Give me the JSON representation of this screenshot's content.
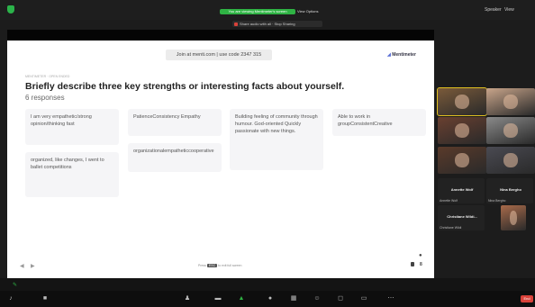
{
  "topbar": {
    "share_banner": "You are viewing Mentimeter's screen",
    "stop_label": "View Options",
    "sharing_note": "Share audio with all · Stop Sharing",
    "view_label": "Speaker",
    "view_label2": "View"
  },
  "slide": {
    "join_text": "Join at menti.com | use code 2347 315",
    "logo_text": "Mentimeter",
    "question_type": "MENTIMETER · OPEN ENDED",
    "question": "Briefly describe three key strengths or interesting facts about yourself.",
    "responses": "6 responses",
    "cards": [
      "I am very empathetic/strong opinion/thinking fast",
      "PatienceConsistency Empathy",
      "Building feeling of community through humour. God-oriented Quickly passionate with new things.",
      "Able to work in groupConsistentCreative",
      "organized, like changes, I went to ballet competitions",
      "organizationalempatheticcooperative"
    ],
    "press_hint_before": "Press",
    "press_hint_key": "ESC",
    "press_hint_after": "to exit full screen",
    "user_count": "8"
  },
  "participants": {
    "tiles": [
      {
        "name": "",
        "color": "#7a5a3a",
        "border": "#e0c020"
      },
      {
        "name": "",
        "color": "#c9a58a",
        "border": ""
      },
      {
        "name": "",
        "color": "#6a4030",
        "border": ""
      },
      {
        "name": "",
        "color": "#8a8a8a",
        "border": ""
      },
      {
        "name": "",
        "color": "#5a3a2a",
        "border": ""
      },
      {
        "name": "",
        "color": "#4a4a52",
        "border": ""
      },
      {
        "name": "",
        "color": "#a86a4a",
        "border": ""
      }
    ],
    "name_tiles": [
      {
        "big": "Annette Wolf",
        "small": "Annette Wolf"
      },
      {
        "big": "Nina Bergho",
        "small": "Nina Bergho"
      },
      {
        "big": "Christiane Wildi...",
        "small": "Christiane Wildi"
      }
    ]
  },
  "toolbar": {
    "end_label": "End"
  }
}
